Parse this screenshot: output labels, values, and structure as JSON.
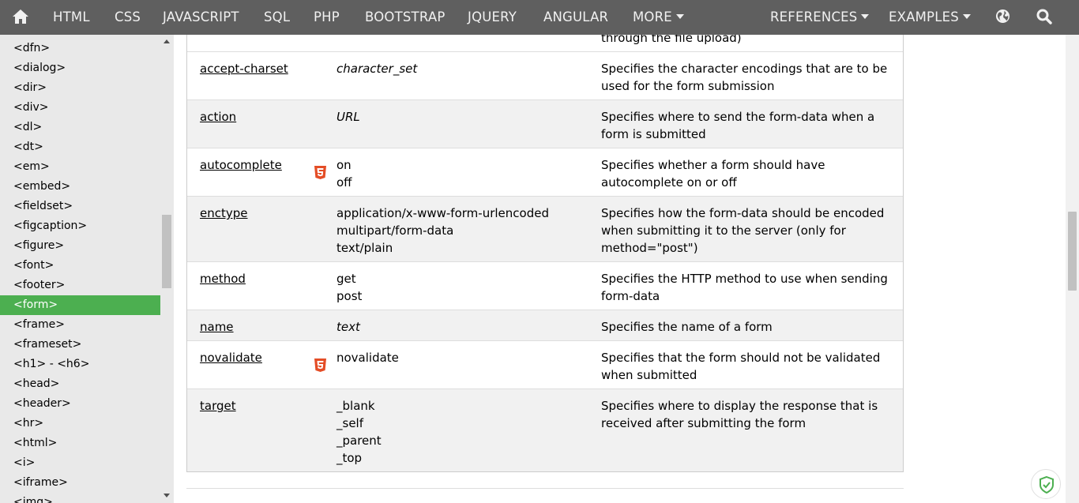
{
  "nav": {
    "items": [
      {
        "label": "HTML",
        "name": "nav-html"
      },
      {
        "label": "CSS",
        "name": "nav-css"
      },
      {
        "label": "JAVASCRIPT",
        "name": "nav-javascript"
      },
      {
        "label": "SQL",
        "name": "nav-sql"
      },
      {
        "label": "PHP",
        "name": "nav-php"
      },
      {
        "label": "BOOTSTRAP",
        "name": "nav-bootstrap"
      },
      {
        "label": "JQUERY",
        "name": "nav-jquery"
      },
      {
        "label": "ANGULAR",
        "name": "nav-angular"
      }
    ],
    "more_label": "MORE",
    "references_label": "REFERENCES",
    "examples_label": "EXAMPLES",
    "icons": [
      "home-icon",
      "globe-icon",
      "search-icon"
    ]
  },
  "sidebar": {
    "items": [
      "<dfn>",
      "<dialog>",
      "<dir>",
      "<div>",
      "<dl>",
      "<dt>",
      "<em>",
      "<embed>",
      "<fieldset>",
      "<figcaption>",
      "<figure>",
      "<font>",
      "<footer>",
      "<form>",
      "<frame>",
      "<frameset>",
      "<h1> - <h6>",
      "<head>",
      "<header>",
      "<hr>",
      "<html>",
      "<i>",
      "<iframe>",
      "<img>"
    ],
    "active": "<form>"
  },
  "table": {
    "top_partial_text": "through the file upload)",
    "rows": [
      {
        "attr": "accept-charset",
        "html5": false,
        "values": [
          "character_set"
        ],
        "italic": true,
        "desc": "Specifies the character encodings that are to be used for the form submission"
      },
      {
        "attr": "action",
        "html5": false,
        "values": [
          "URL"
        ],
        "italic": true,
        "desc": "Specifies where to send the form-data when a form is submitted"
      },
      {
        "attr": "autocomplete",
        "html5": true,
        "values": [
          "on",
          "off"
        ],
        "italic": false,
        "desc": "Specifies whether a form should have autocomplete on or off"
      },
      {
        "attr": "enctype",
        "html5": false,
        "values": [
          "application/x-www-form-urlencoded",
          "multipart/form-data",
          "text/plain"
        ],
        "italic": false,
        "desc": "Specifies how the form-data should be encoded when submitting it to the server (only for method=\"post\")"
      },
      {
        "attr": "method",
        "html5": false,
        "values": [
          "get",
          "post"
        ],
        "italic": false,
        "desc": "Specifies the HTTP method to use when sending form-data"
      },
      {
        "attr": "name",
        "html5": false,
        "values": [
          "text"
        ],
        "italic": true,
        "desc": "Specifies the name of a form"
      },
      {
        "attr": "novalidate",
        "html5": true,
        "values": [
          "novalidate"
        ],
        "italic": false,
        "desc": "Specifies that the form should not be validated when submitted"
      },
      {
        "attr": "target",
        "html5": false,
        "values": [
          "_blank",
          "_self",
          "_parent",
          "_top"
        ],
        "italic": false,
        "desc": "Specifies where to display the response that is received after submitting the form"
      }
    ]
  },
  "colors": {
    "nav_bg": "#5f5f5f",
    "sidebar_bg": "#e9e9e9",
    "active_bg": "#4caf50",
    "html5_badge": "#e44d26",
    "row_gray": "#f1f1f1"
  }
}
